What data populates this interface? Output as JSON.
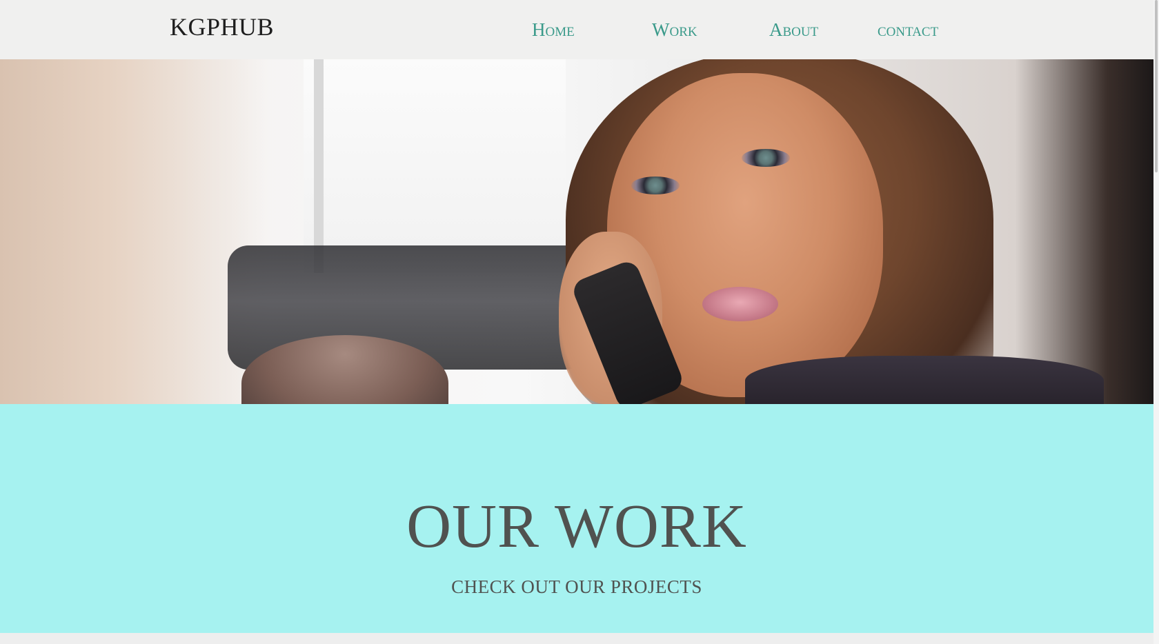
{
  "header": {
    "logo": "KGPHUB",
    "nav": [
      {
        "label": "Home"
      },
      {
        "label": "Work"
      },
      {
        "label": "About"
      },
      {
        "label": "contact"
      }
    ]
  },
  "hero": {
    "image": "woman on phone photo"
  },
  "work_section": {
    "title": "OUR WORK",
    "subtitle": "CHECK OUT OUR PROJECTS",
    "background_color": "#a6f2f0"
  }
}
